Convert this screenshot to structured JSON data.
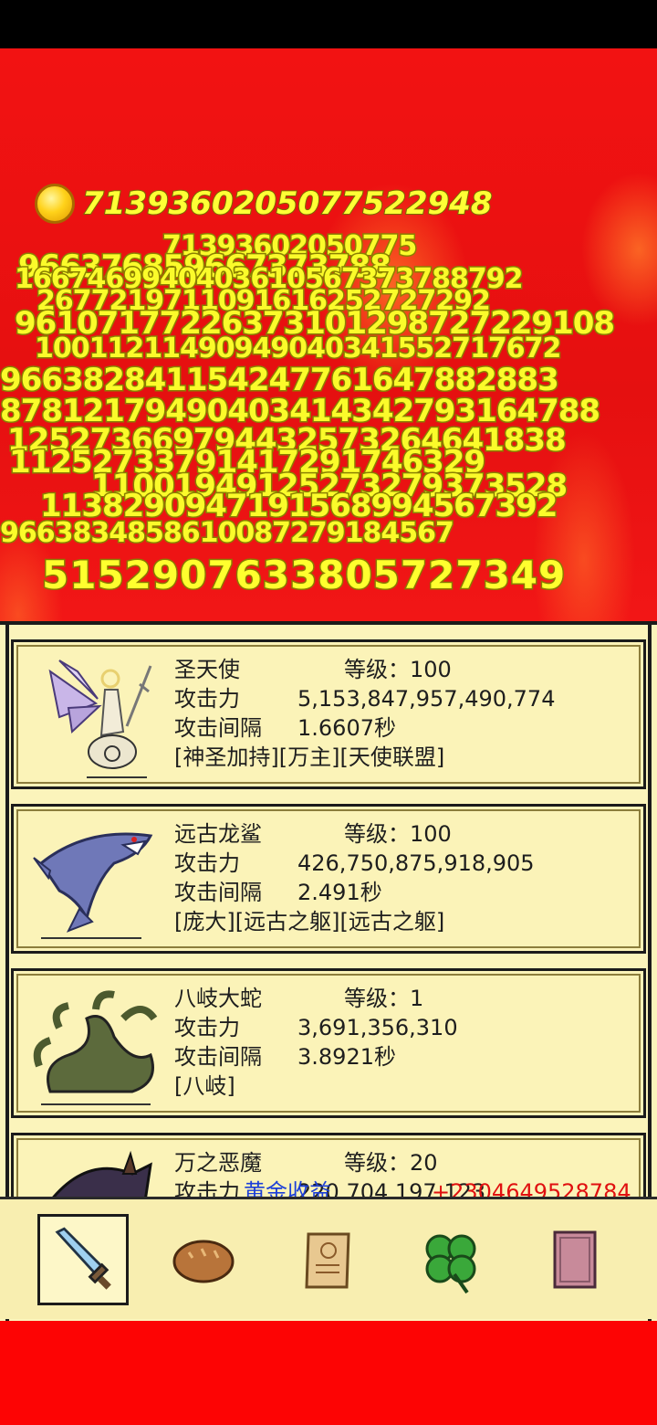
{
  "gold": {
    "value": "7139360205077522948"
  },
  "floating_damage": [
    "71393602050775",
    "966376859667373788",
    "1667469940403610567373788792",
    "2677219711091616252727292",
    "96107177226373101298727229108",
    "10011211490949040341552717672",
    "966382841154247761647882883",
    "87812179490403414342793164788",
    "125273669794432573264641838",
    "11252733791417291746329",
    "11001949125273279373528",
    "1138290947191568994567392",
    "9663834858610087279184567"
  ],
  "total_damage": "5152907633805727349",
  "units": [
    {
      "name": "圣天使",
      "level_label": "等级：",
      "level": "100",
      "attack_label": "攻击力",
      "attack": "5,153,847,957,490,774",
      "interval_label": "攻击间隔",
      "interval": "1.6607秒",
      "traits": "[神圣加持][万主][天使联盟]"
    },
    {
      "name": "远古龙鲨",
      "level_label": "等级：",
      "level": "100",
      "attack_label": "攻击力",
      "attack": "426,750,875,918,905",
      "interval_label": "攻击间隔",
      "interval": "2.491秒",
      "traits": "[庞大][远古之躯][远古之躯]"
    },
    {
      "name": "八岐大蛇",
      "level_label": "等级：",
      "level": "1",
      "attack_label": "攻击力",
      "attack": "3,691,356,310",
      "interval_label": "攻击间隔",
      "interval": "3.8921秒",
      "traits": "[八岐]"
    },
    {
      "name": "万之恶魔",
      "level_label": "等级：",
      "level": "20",
      "attack_label": "攻击力",
      "attack": "220,704,197,123",
      "overlay_blue": "黄金收益",
      "overlay_red": "+2304649528784"
    }
  ],
  "nav": [
    {
      "icon": "sword-icon",
      "active": true
    },
    {
      "icon": "bread-icon",
      "active": false
    },
    {
      "icon": "scroll-icon",
      "active": false
    },
    {
      "icon": "clover-icon",
      "active": false
    },
    {
      "icon": "book-icon",
      "active": false
    }
  ],
  "colors": {
    "background_red": "#fb0505",
    "panel": "#fbf4bb",
    "gold_text": "#ffff35"
  }
}
